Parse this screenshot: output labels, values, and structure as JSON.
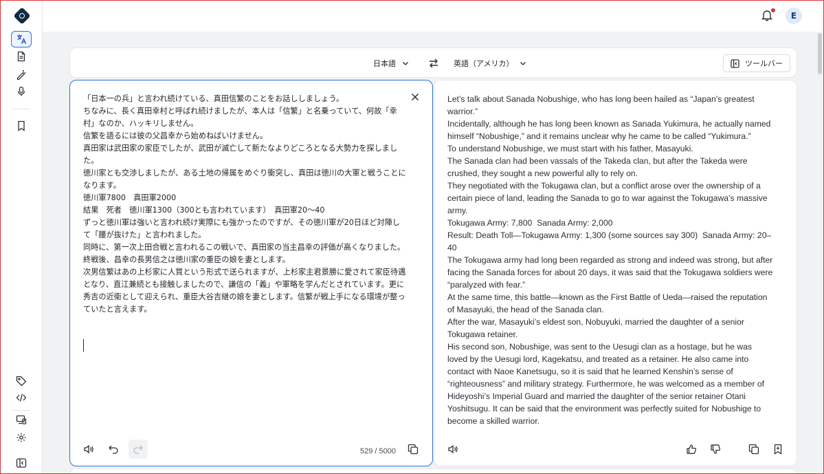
{
  "header": {
    "notification_icon": "bell-icon",
    "avatar_initial": "E"
  },
  "rail": {
    "items": [
      {
        "name": "translate",
        "icon": "translate-icon",
        "active": true
      },
      {
        "name": "document",
        "icon": "document-icon"
      },
      {
        "name": "write",
        "icon": "magic-pen-icon"
      },
      {
        "name": "voice",
        "icon": "microphone-icon"
      },
      {
        "name": "saved",
        "icon": "bookmark-icon"
      },
      {
        "name": "glossary",
        "icon": "tag-icon"
      },
      {
        "name": "api",
        "icon": "code-icon"
      },
      {
        "name": "apps",
        "icon": "devices-icon"
      },
      {
        "name": "settings",
        "icon": "gear-icon"
      },
      {
        "name": "collapse",
        "icon": "sidebar-toggle-icon"
      }
    ]
  },
  "langbar": {
    "source_lang": "日本語",
    "target_lang": "英語（アメリカ）",
    "toolbar_label": "ツールバー"
  },
  "source": {
    "text": "「日本一の兵」と言われ続けている、真田信繁のことをお話ししましょう。\nちなみに、長く真田幸村と呼ばれ続けましたが、本人は「信繁」と名乗っていて、何故「幸村」なのか、ハッキリしません。\n信繁を語るには彼の父昌幸から始めねばいけません。\n真田家は武田家の家臣でしたが、武田が滅亡して新たなよりどころとなる大勢力を探しました。\n徳川家とも交渉しましたが、ある土地の帰属をめぐり衝突し、真田は徳川の大軍と戦うことになります。\n徳川軍7800　真田軍2000\n結果　死者　徳川軍1300（300とも言われています）　真田軍20〜40\nずっと徳川軍は強いと言われ続け実際にも強かったのですが、その徳川軍が20日ほど対陣して「腰が抜けた」と言われました。\n同時に、第一次上田合戦と言われるこの戦いで、真田家の当主昌幸の評価が高くなりました。\n終戦後、昌幸の長男信之は徳川家の重臣の娘を妻とします。\n次男信繁はあの上杉家に人質という形式で送られますが、上杉家主君景勝に愛されて家臣待遇となり、直江兼続とも接触しましたので、謙信の「義」や軍略を学んだとされています。更に秀吉の近衛として迎えられ、重臣大谷吉継の娘を妻とします。信繁が戦上手になる環境が整っていたと言えます。",
    "char_count": "529 / 5000"
  },
  "target": {
    "text": "Let’s talk about Sanada Nobushige, who has long been hailed as “Japan’s greatest warrior.”\nIncidentally, although he has long been known as Sanada Yukimura, he actually named himself “Nobushige,” and it remains unclear why he came to be called “Yukimura.”\nTo understand Nobushige, we must start with his father, Masayuki.\nThe Sanada clan had been vassals of the Takeda clan, but after the Takeda were crushed, they sought a new powerful ally to rely on.\nThey negotiated with the Tokugawa clan, but a conflict arose over the ownership of a certain piece of land, leading the Sanada to go to war against the Tokugawa’s massive army.\nTokugawa Army: 7,800  Sanada Army: 2,000\nResult: Death Toll—Tokugawa Army: 1,300 (some sources say 300)  Sanada Army: 20–40\nThe Tokugawa army had long been regarded as strong and indeed was strong, but after facing the Sanada forces for about 20 days, it was said that the Tokugawa soldiers were “paralyzed with fear.”\nAt the same time, this battle—known as the First Battle of Ueda—raised the reputation of Masayuki, the head of the Sanada clan.\nAfter the war, Masayuki’s eldest son, Nobuyuki, married the daughter of a senior Tokugawa retainer.\nHis second son, Nobushige, was sent to the Uesugi clan as a hostage, but he was loved by the Uesugi lord, Kagekatsu, and treated as a retainer. He also came into contact with Naoe Kanetsugu, so it is said that he learned Kenshin’s sense of “righteousness” and military strategy. Furthermore, he was welcomed as a member of Hideyoshi’s Imperial Guard and married the daughter of the senior retainer Otani Yoshitsugu. It can be said that the environment was perfectly suited for Nobushige to become a skilled warrior."
  }
}
